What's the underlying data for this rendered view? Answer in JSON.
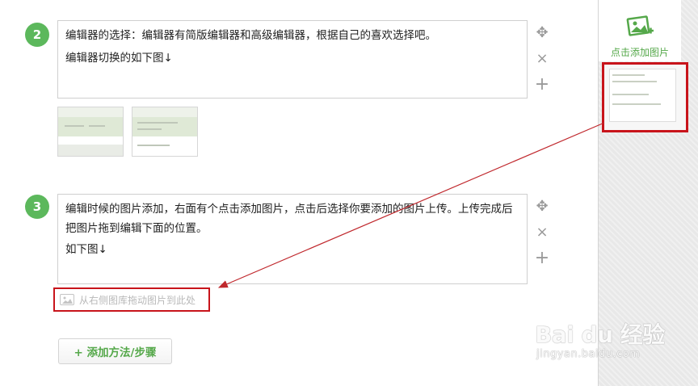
{
  "steps": [
    {
      "number": "2",
      "lines": [
        "编辑器的选择：编辑器有简版编辑器和高级编辑器，根据自己的喜欢选择吧。",
        "编辑器切换的如下图↓"
      ]
    },
    {
      "number": "3",
      "lines": [
        "编辑时候的图片添加，右面有个点击添加图片，点击后选择你要添加的图片上传。上传完成后把图片拖到编辑下面的位置。",
        "如下图↓"
      ]
    }
  ],
  "tools": {
    "move_icon": "✥",
    "delete_icon": "×",
    "add_icon": "+"
  },
  "placeholder_text": "从右侧图库拖动图片到此处",
  "add_step_label": "+ 添加方法/步骤",
  "sidebar": {
    "add_image_label": "点击添加图片"
  },
  "watermark": {
    "logo": "Bai du 经验",
    "url": "jingyan.baidu.com"
  },
  "colors": {
    "accent_green": "#5cb85c",
    "highlight_red": "#c8141b",
    "arrow_red": "#c0282d"
  }
}
